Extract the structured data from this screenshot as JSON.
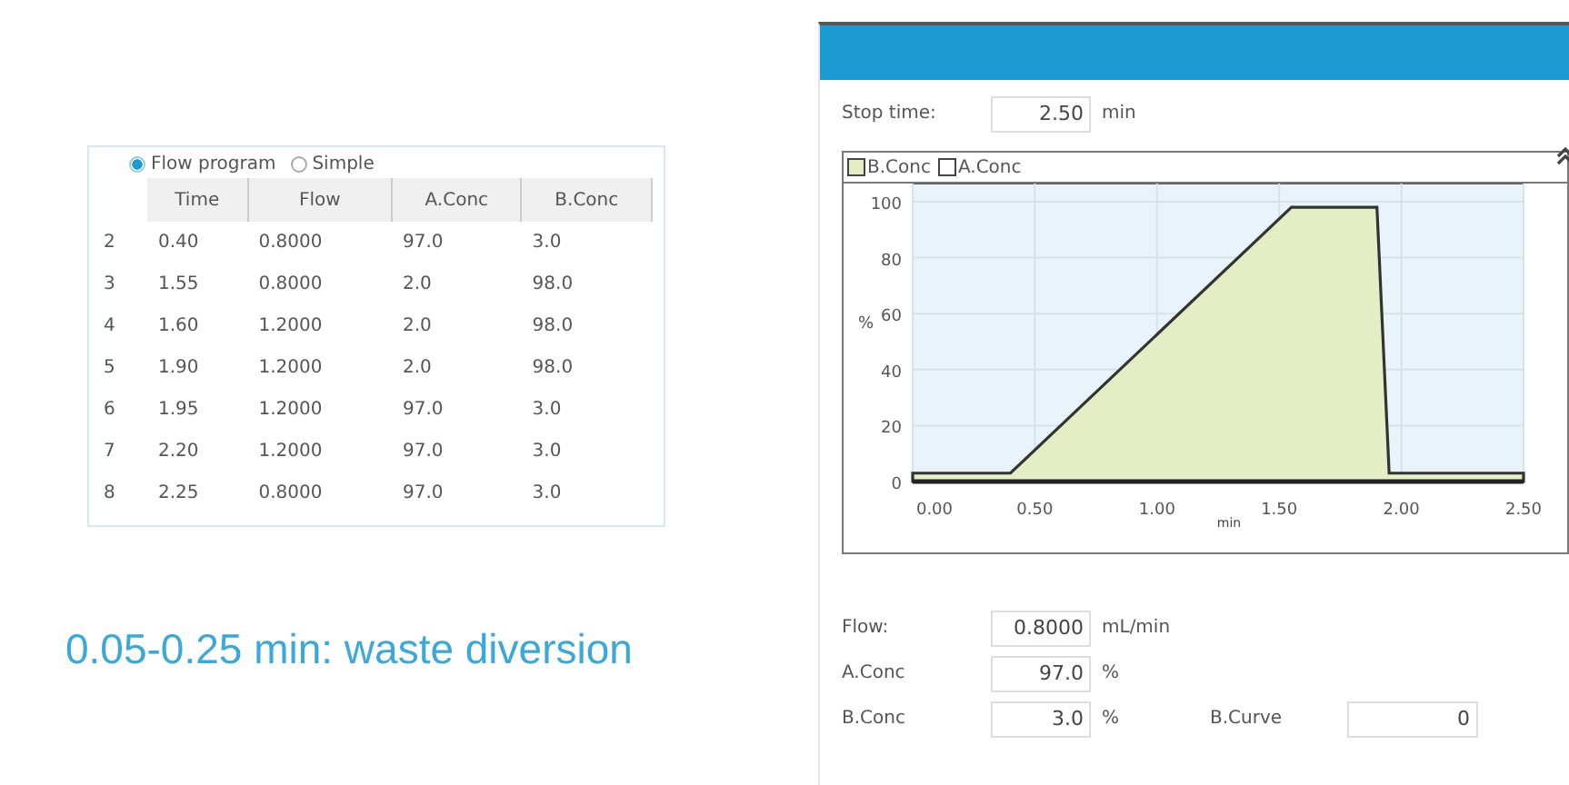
{
  "program_table": {
    "mode_options": [
      {
        "label": "Flow program",
        "selected": true
      },
      {
        "label": "Simple",
        "selected": false
      }
    ],
    "columns": [
      "Time",
      "Flow",
      "A.Conc",
      "B.Conc"
    ],
    "rows": [
      {
        "number": "2",
        "cells": [
          "0.40",
          "0.8000",
          "97.0",
          "3.0"
        ]
      },
      {
        "number": "3",
        "cells": [
          "1.55",
          "0.8000",
          "2.0",
          "98.0"
        ]
      },
      {
        "number": "4",
        "cells": [
          "1.60",
          "1.2000",
          "2.0",
          "98.0"
        ]
      },
      {
        "number": "5",
        "cells": [
          "1.90",
          "1.2000",
          "2.0",
          "98.0"
        ]
      },
      {
        "number": "6",
        "cells": [
          "1.95",
          "1.2000",
          "97.0",
          "3.0"
        ]
      },
      {
        "number": "7",
        "cells": [
          "2.20",
          "1.2000",
          "97.0",
          "3.0"
        ]
      },
      {
        "number": "8",
        "cells": [
          "2.25",
          "0.8000",
          "97.0",
          "3.0"
        ]
      }
    ]
  },
  "caption": "0.05-0.25 min: waste diversion",
  "settings": {
    "stop_time": {
      "label": "Stop time:",
      "value": "2.50",
      "unit": "min"
    },
    "legend_extra": [
      {
        "label": "A.Conc",
        "color": "#ffffff"
      }
    ],
    "chart_data": {
      "type": "area",
      "xlabel": "min",
      "ylabel": "%",
      "x": [
        0,
        0.4,
        1.55,
        1.6,
        1.9,
        1.95,
        2.2,
        2.25,
        2.5
      ],
      "series": [
        {
          "name": "B.Conc",
          "color": "#e3eec4",
          "values": [
            3,
            3,
            98,
            98,
            98,
            3,
            3,
            3,
            3
          ]
        }
      ],
      "xlim": [
        0,
        2.5
      ],
      "ylim": [
        0,
        100
      ],
      "xticks": [
        {
          "value": 0,
          "label": "0.00"
        },
        {
          "value": 0.5,
          "label": "0.50"
        },
        {
          "value": 1,
          "label": "1.00"
        },
        {
          "value": 1.5,
          "label": "1.50"
        },
        {
          "value": 2,
          "label": "2.00"
        },
        {
          "value": 2.5,
          "label": "2.50"
        }
      ],
      "yticks": [
        0,
        20,
        40,
        60,
        80,
        100
      ],
      "grid": true
    },
    "fields": [
      {
        "label": "Flow:",
        "value": "0.8000",
        "unit": "mL/min"
      },
      {
        "label": "A.Conc",
        "value": "97.0",
        "unit": "%"
      },
      {
        "label": "B.Conc",
        "value": "3.0",
        "unit": "%"
      }
    ],
    "curve": {
      "label": "B.Curve",
      "value": "0"
    }
  }
}
